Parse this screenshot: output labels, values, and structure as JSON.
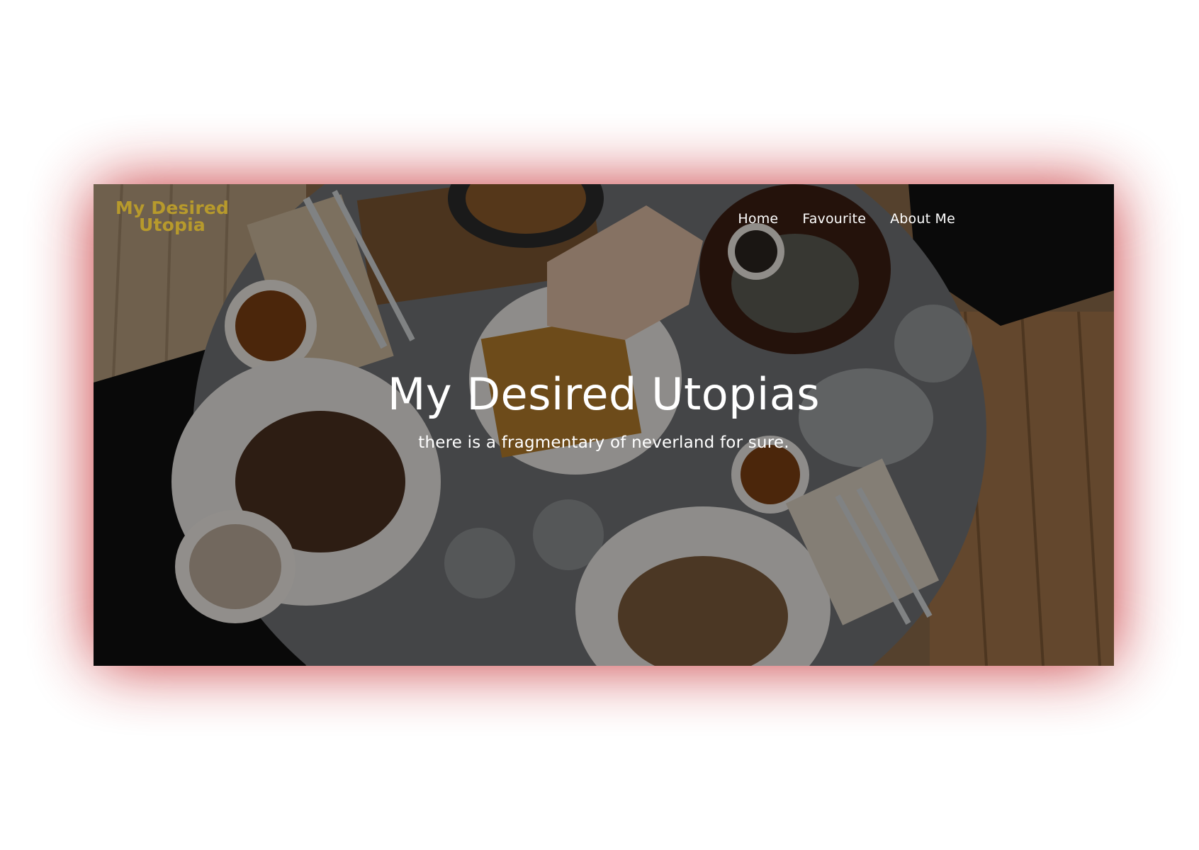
{
  "site": {
    "logo_text": "My Desired Utopia",
    "logo_color": "#b79a2c"
  },
  "nav": {
    "items": [
      {
        "label": "Home"
      },
      {
        "label": "Favourite"
      },
      {
        "label": "About Me"
      }
    ]
  },
  "hero": {
    "title": "My Desired Utopias",
    "subtitle": "there is a fragmentary of neverland for sure.",
    "glow_color": "#c42a2e"
  }
}
